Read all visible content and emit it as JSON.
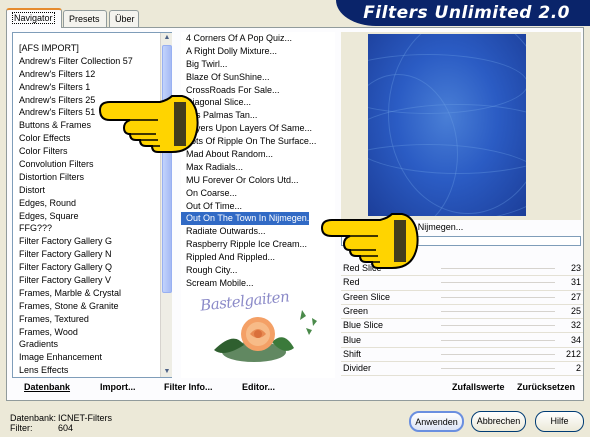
{
  "tabs": [
    {
      "label": "Navigator",
      "active": true
    },
    {
      "label": "Presets",
      "active": false
    },
    {
      "label": "Über",
      "active": false
    }
  ],
  "banner": {
    "title": "Filters Unlimited 2.0"
  },
  "categories": [
    "[AFS IMPORT]",
    "Andrew's Filter Collection 57",
    "Andrew's Filters 12",
    "Andrew's Filters 1",
    "Andrew's Filters 25",
    "Andrew's Filters 51",
    "Buttons & Frames",
    "Color Effects",
    "Color Filters",
    "Convolution Filters",
    "Distortion Filters",
    "Distort",
    "Edges, Round",
    "Edges, Square",
    "FFG???",
    "Filter Factory Gallery G",
    "Filter Factory Gallery N",
    "Filter Factory Gallery Q",
    "Filter Factory Gallery V",
    "Frames, Marble & Crystal",
    "Frames, Stone & Granite",
    "Frames, Textured",
    "Frames, Wood",
    "Gradients",
    "Image Enhancement",
    "Lens Effects"
  ],
  "filters": [
    "4 Corners Of A Pop Quiz...",
    "A Right Dolly Mixture...",
    "Big Twirl...",
    "Blaze Of SunShine...",
    "CrossRoads For Sale...",
    "Diagonal Slice...",
    "Las Palmas Tan...",
    "Layers Upon Layers Of Same...",
    "Lots Of Ripple On The Surface...",
    "Mad About Random...",
    "Max Radials...",
    "MU Forever Or Colors Utd...",
    "On Coarse...",
    "Out Of Time...",
    "Out On The Town In Nijmegen...",
    "Radiate Outwards...",
    "Raspberry Ripple Ice Cream...",
    "Rippled And Rippled...",
    "Rough City...",
    "Scream Mobile..."
  ],
  "selected_filter": "Out On The Town In Nijmegen...",
  "selected_filter_index": 14,
  "preview": {
    "caption": "On The Town In Nijmegen..."
  },
  "params": [
    {
      "label": "Red Slice",
      "value": "23"
    },
    {
      "label": "Red",
      "value": "31"
    },
    {
      "label": "Green Slice",
      "value": "27"
    },
    {
      "label": "Green",
      "value": "25"
    },
    {
      "label": "Blue Slice",
      "value": "32"
    },
    {
      "label": "Blue",
      "value": "34"
    },
    {
      "label": "Shift",
      "value": "212"
    },
    {
      "label": "Divider",
      "value": "2"
    }
  ],
  "toolbar": {
    "datenbank": "Datenbank",
    "import": "Import...",
    "filter_info": "Filter Info...",
    "editor": "Editor...",
    "zufallswerte": "Zufallswerte",
    "zuruecksetzen": "Zurücksetzen"
  },
  "status": {
    "db_label": "Datenbank:",
    "db_value": "ICNET-Filters",
    "filter_label": "Filter:",
    "filter_value": "604"
  },
  "buttons": {
    "apply": "Anwenden",
    "cancel": "Abbrechen",
    "help": "Hilfe"
  },
  "watermark": {
    "text": "Bastelgaiten"
  },
  "colors": {
    "banner_bg": "#0a246a",
    "selection": "#316ac5",
    "hand": "#ffd400",
    "preview": "#2b5cc4"
  }
}
